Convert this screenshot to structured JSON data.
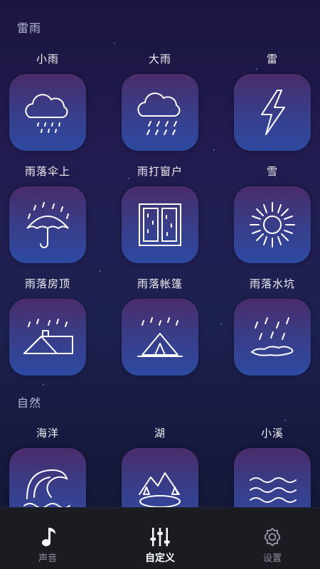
{
  "sections": [
    {
      "title": "雷雨",
      "items": [
        {
          "label": "小雨",
          "icon": "light-rain-cloud-icon"
        },
        {
          "label": "大雨",
          "icon": "heavy-rain-cloud-icon"
        },
        {
          "label": "雷",
          "icon": "lightning-icon"
        },
        {
          "label": "雨落伞上",
          "icon": "rain-on-umbrella-icon"
        },
        {
          "label": "雨打窗户",
          "icon": "rain-on-window-icon"
        },
        {
          "label": "雪",
          "icon": "snowflake-icon"
        },
        {
          "label": "雨落房顶",
          "icon": "rain-on-roof-icon"
        },
        {
          "label": "雨落帐篷",
          "icon": "rain-on-tent-icon"
        },
        {
          "label": "雨落水坑",
          "icon": "rain-in-puddle-icon"
        }
      ]
    },
    {
      "title": "自然",
      "items": [
        {
          "label": "海洋",
          "icon": "ocean-wave-icon"
        },
        {
          "label": "湖",
          "icon": "lake-icon"
        },
        {
          "label": "小溪",
          "icon": "stream-icon"
        }
      ]
    }
  ],
  "tabbar": {
    "tabs": [
      {
        "label": "声音",
        "icon": "music-note-icon",
        "active": false
      },
      {
        "label": "自定义",
        "icon": "equalizer-icon",
        "active": true
      },
      {
        "label": "设置",
        "icon": "gear-icon",
        "active": false
      }
    ]
  },
  "colors": {
    "tile_top": "#4a2c6a",
    "tile_bottom": "#2d4aa2",
    "tab_active": "#ffffff",
    "tab_inactive": "#8e8ea0"
  }
}
